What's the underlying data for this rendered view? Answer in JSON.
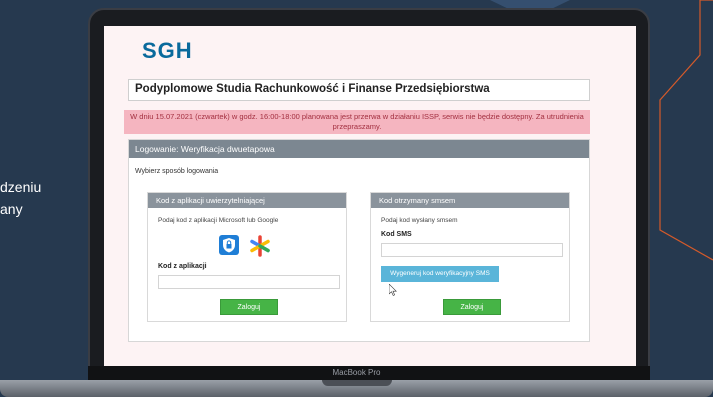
{
  "side_text": [
    "dzeniu",
    "any"
  ],
  "device_label": "MacBook Pro",
  "page": {
    "logo": "SGH",
    "title": "Podyplomowe Studia Rachunkowość i Finanse Przedsiębiorstwa",
    "alert": "W dniu 15.07.2021 (czwartek) w godz. 16:00-18:00 planowana jest przerwa w działaniu ISSP, serwis nie będzie dostępny. Za utrudnienia przepraszamy.",
    "login_header": "Logowanie: Weryfikacja dwuetapowa",
    "choose_method": "Wybierz sposób logowania",
    "app_card": {
      "header": "Kod z aplikacji uwierzytelniającej",
      "instruction": "Podaj kod z aplikacji Microsoft lub Google",
      "field_label": "Kod z aplikacji",
      "field_value": "",
      "button": "Zaloguj"
    },
    "sms_card": {
      "header": "Kod otrzymany smsem",
      "instruction": "Podaj kod wysłany smsem",
      "field_label": "Kod SMS",
      "field_value": "",
      "send_button": "Wygeneruj kod weryfikacyjny SMS",
      "button": "Zaloguj"
    }
  },
  "colors": {
    "background": "#26394f",
    "accent_line": "#d45a2a",
    "logo": "#0a6a9c",
    "alert_bg": "#f5b5c0",
    "header_bg": "#7c8791",
    "button_green": "#46b446",
    "button_blue": "#5ab5d9"
  },
  "icons": [
    "microsoft-authenticator-icon",
    "google-authenticator-icon",
    "mouse-cursor-icon"
  ]
}
